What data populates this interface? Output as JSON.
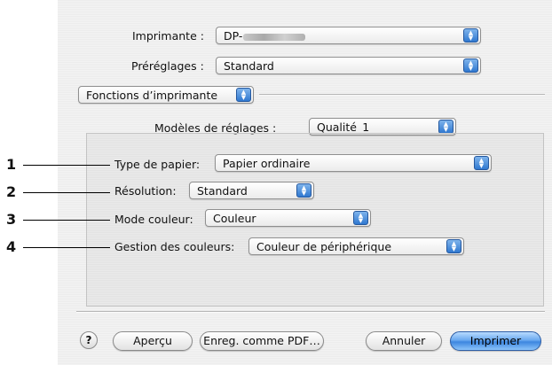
{
  "printer": {
    "label": "Imprimante :",
    "value": "DP-"
  },
  "presets": {
    "label": "Préréglages :",
    "value": "Standard"
  },
  "panel_select": {
    "value": "Fonctions d’imprimante"
  },
  "models": {
    "label": "Modèles de réglages :",
    "value": "Qualité_1"
  },
  "settings": [
    {
      "number": "1",
      "label": "Type de papier:",
      "value": "Papier ordinaire"
    },
    {
      "number": "2",
      "label": "Résolution:",
      "value": "Standard"
    },
    {
      "number": "3",
      "label": "Mode couleur:",
      "value": "Couleur"
    },
    {
      "number": "4",
      "label": "Gestion des couleurs:",
      "value": "Couleur de périphérique"
    }
  ],
  "buttons": {
    "help": "?",
    "preview": "Aperçu",
    "save_pdf": "Enreg. comme PDF…",
    "cancel": "Annuler",
    "print": "Imprimer"
  },
  "icons": {
    "popup_arrows": "updown-arrows-icon",
    "help": "help-icon"
  },
  "colors": {
    "accent": "#3c86e0"
  }
}
